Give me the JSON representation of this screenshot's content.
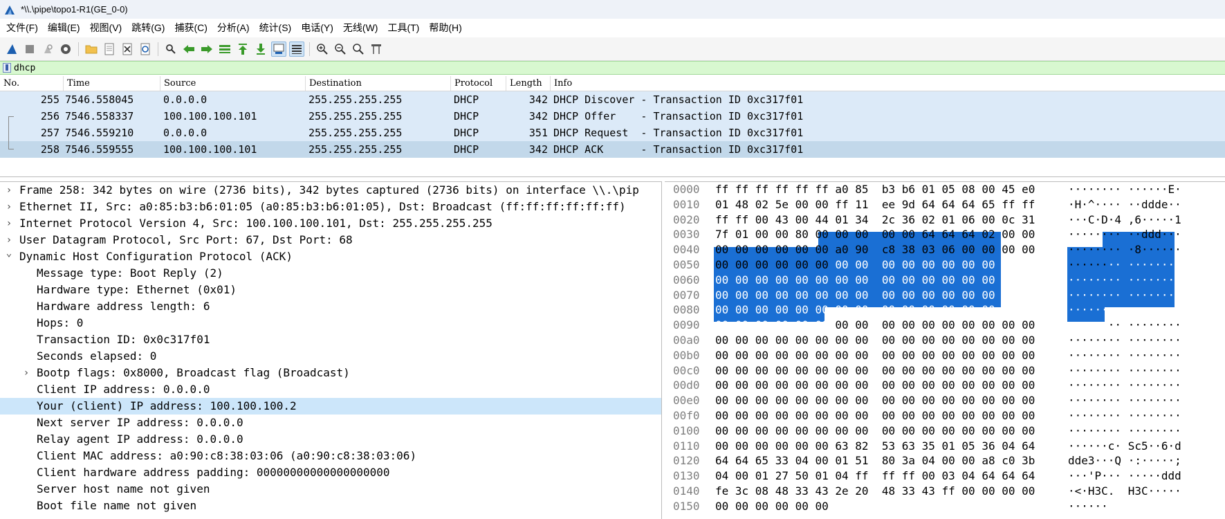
{
  "window": {
    "title": "*\\\\.\\pipe\\topo1-R1(GE_0-0)"
  },
  "menu": [
    "文件(F)",
    "编辑(E)",
    "视图(V)",
    "跳转(G)",
    "捕获(C)",
    "分析(A)",
    "统计(S)",
    "电话(Y)",
    "无线(W)",
    "工具(T)",
    "帮助(H)"
  ],
  "toolbar": {
    "buttons": [
      "shark-fin-start-icon",
      "stop-icon",
      "restart-icon",
      "options-gear-icon",
      "open-folder-icon",
      "save-file-icon",
      "close-file-icon",
      "reload-icon",
      "find-icon",
      "back-arrow-icon",
      "forward-arrow-icon",
      "go-to-packet-icon",
      "first-packet-icon",
      "last-packet-icon",
      "autoscroll-icon",
      "colorize-icon",
      "zoom-in-icon",
      "zoom-out-icon",
      "zoom-normal-icon",
      "resize-columns-icon"
    ],
    "colors": {
      "green": "#3a9a2a",
      "blue": "#1c5fb0"
    }
  },
  "filter": {
    "value": "dhcp"
  },
  "packet_list": {
    "columns": [
      "No.",
      "Time",
      "Source",
      "Destination",
      "Protocol",
      "Length",
      "Info"
    ],
    "rows": [
      {
        "no": "255",
        "time": "7546.558045",
        "src": "0.0.0.0",
        "dst": "255.255.255.255",
        "proto": "DHCP",
        "len": "342",
        "info": "DHCP Discover - Transaction ID 0xc317f01"
      },
      {
        "no": "256",
        "time": "7546.558337",
        "src": "100.100.100.101",
        "dst": "255.255.255.255",
        "proto": "DHCP",
        "len": "342",
        "info": "DHCP Offer    - Transaction ID 0xc317f01"
      },
      {
        "no": "257",
        "time": "7546.559210",
        "src": "0.0.0.0",
        "dst": "255.255.255.255",
        "proto": "DHCP",
        "len": "351",
        "info": "DHCP Request  - Transaction ID 0xc317f01"
      },
      {
        "no": "258",
        "time": "7546.559555",
        "src": "100.100.100.101",
        "dst": "255.255.255.255",
        "proto": "DHCP",
        "len": "342",
        "info": "DHCP ACK      - Transaction ID 0xc317f01"
      }
    ],
    "selected_index": 3
  },
  "details": [
    {
      "level": 0,
      "arrow": ">",
      "text": "Frame 258: 342 bytes on wire (2736 bits), 342 bytes captured (2736 bits) on interface \\\\.\\pip"
    },
    {
      "level": 0,
      "arrow": ">",
      "text": "Ethernet II, Src: a0:85:b3:b6:01:05 (a0:85:b3:b6:01:05), Dst: Broadcast (ff:ff:ff:ff:ff:ff)"
    },
    {
      "level": 0,
      "arrow": ">",
      "text": "Internet Protocol Version 4, Src: 100.100.100.101, Dst: 255.255.255.255"
    },
    {
      "level": 0,
      "arrow": ">",
      "text": "User Datagram Protocol, Src Port: 67, Dst Port: 68"
    },
    {
      "level": 0,
      "arrow": "v",
      "text": "Dynamic Host Configuration Protocol (ACK)"
    },
    {
      "level": 1,
      "arrow": "",
      "text": "Message type: Boot Reply (2)"
    },
    {
      "level": 1,
      "arrow": "",
      "text": "Hardware type: Ethernet (0x01)"
    },
    {
      "level": 1,
      "arrow": "",
      "text": "Hardware address length: 6"
    },
    {
      "level": 1,
      "arrow": "",
      "text": "Hops: 0"
    },
    {
      "level": 1,
      "arrow": "",
      "text": "Transaction ID: 0x0c317f01"
    },
    {
      "level": 1,
      "arrow": "",
      "text": "Seconds elapsed: 0"
    },
    {
      "level": 1,
      "arrow": ">",
      "text": "Bootp flags: 0x8000, Broadcast flag (Broadcast)"
    },
    {
      "level": 1,
      "arrow": "",
      "text": "Client IP address: 0.0.0.0"
    },
    {
      "level": 1,
      "arrow": "",
      "text": "Your (client) IP address: 100.100.100.2",
      "highlight": true
    },
    {
      "level": 1,
      "arrow": "",
      "text": "Next server IP address: 0.0.0.0"
    },
    {
      "level": 1,
      "arrow": "",
      "text": "Relay agent IP address: 0.0.0.0"
    },
    {
      "level": 1,
      "arrow": "",
      "text": "Client MAC address: a0:90:c8:38:03:06 (a0:90:c8:38:03:06)"
    },
    {
      "level": 1,
      "arrow": "",
      "text": "Client hardware address padding: 00000000000000000000"
    },
    {
      "level": 1,
      "arrow": "",
      "text": "Server host name not given"
    },
    {
      "level": 1,
      "arrow": "",
      "text": "Boot file name not given"
    }
  ],
  "bytes": [
    {
      "off": "0000",
      "hex": "ff ff ff ff ff ff a0 85  b3 b6 01 05 08 00 45 e0",
      "asc": "········ ······E·"
    },
    {
      "off": "0010",
      "hex": "01 48 02 5e 00 00 ff 11  ee 9d 64 64 64 65 ff ff",
      "asc": "·H·^···· ··dddе··"
    },
    {
      "off": "0020",
      "hex": "ff ff 00 43 00 44 01 34  2c 36 02 01 06 00 0c 31",
      "asc": "···C·D·4 ,6·····1"
    },
    {
      "off": "0030",
      "hex": "7f 01 00 00 80 00 00 00  00 00 64 64 64 02 00 00",
      "asc": "········ ··ddd···"
    },
    {
      "off": "0040",
      "hex": "00 00 00 00 00 00 a0 90  c8 38 03 06 00 00 00 00",
      "asc": "········ ·8······"
    },
    {
      "off": "0050",
      "hex": "00 00 00 00 00 00 00 00  00 00 00 00 00 00 00 00",
      "asc": "········ ········"
    },
    {
      "off": "0060",
      "hex": "00 00 00 00 00 00 00 00  00 00 00 00 00 00 00 00",
      "asc": "········ ········"
    },
    {
      "off": "0070",
      "hex": "00 00 00 00 00 00 00 00  00 00 00 00 00 00 00 00",
      "asc": "········ ········"
    },
    {
      "off": "0080",
      "hex": "00 00 00 00 00 00 00 00  00 00 00 00 00 00 00 00",
      "asc": "········ ········"
    },
    {
      "off": "0090",
      "hex": "00 00 00 00 00 00 00 00  00 00 00 00 00 00 00 00",
      "asc": "········ ········"
    },
    {
      "off": "00a0",
      "hex": "00 00 00 00 00 00 00 00  00 00 00 00 00 00 00 00",
      "asc": "········ ········"
    },
    {
      "off": "00b0",
      "hex": "00 00 00 00 00 00 00 00  00 00 00 00 00 00 00 00",
      "asc": "········ ········"
    },
    {
      "off": "00c0",
      "hex": "00 00 00 00 00 00 00 00  00 00 00 00 00 00 00 00",
      "asc": "········ ········"
    },
    {
      "off": "00d0",
      "hex": "00 00 00 00 00 00 00 00  00 00 00 00 00 00 00 00",
      "asc": "········ ········"
    },
    {
      "off": "00e0",
      "hex": "00 00 00 00 00 00 00 00  00 00 00 00 00 00 00 00",
      "asc": "········ ········"
    },
    {
      "off": "00f0",
      "hex": "00 00 00 00 00 00 00 00  00 00 00 00 00 00 00 00",
      "asc": "········ ········"
    },
    {
      "off": "0100",
      "hex": "00 00 00 00 00 00 00 00  00 00 00 00 00 00 00 00",
      "asc": "········ ········"
    },
    {
      "off": "0110",
      "hex": "00 00 00 00 00 00 63 82  53 63 35 01 05 36 04 64",
      "asc": "······c· Sc5··6·d"
    },
    {
      "off": "0120",
      "hex": "64 64 65 33 04 00 01 51  80 3a 04 00 00 a8 c0 3b",
      "asc": "dde3···Q ·:·····;"
    },
    {
      "off": "0130",
      "hex": "04 00 01 27 50 01 04 ff  ff ff 00 03 04 64 64 64",
      "asc": "···'P··· ·····ddd"
    },
    {
      "off": "0140",
      "hex": "fe 3c 08 48 33 43 2e 20  48 33 43 ff 00 00 00 00",
      "asc": "·<·H3C.  H3C·····"
    },
    {
      "off": "0150",
      "hex": "00 00 00 00 00 00",
      "asc": "······"
    }
  ]
}
